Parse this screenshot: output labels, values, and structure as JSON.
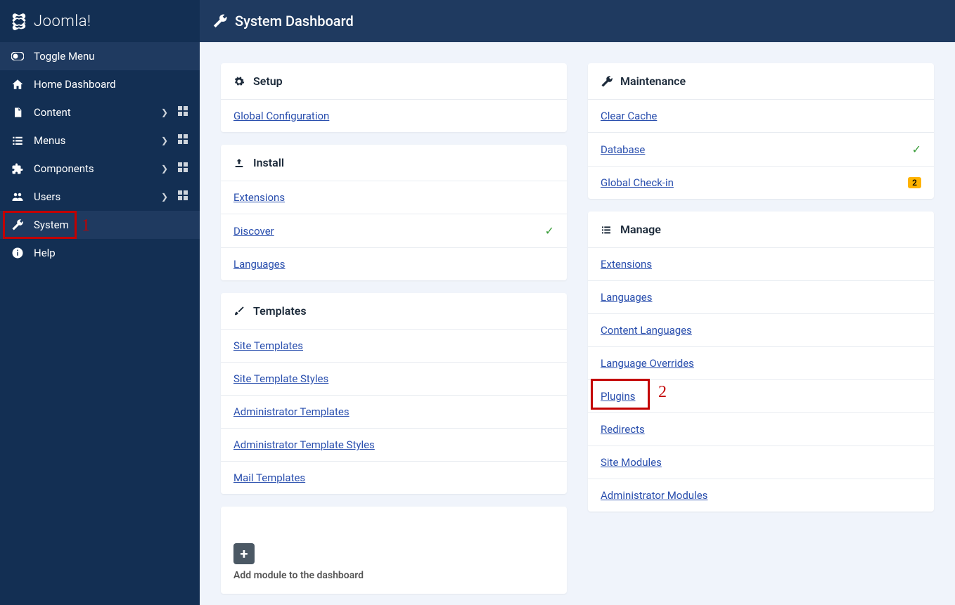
{
  "brand": "Joomla!",
  "page_title": "System Dashboard",
  "sidebar": {
    "toggle": "Toggle Menu",
    "items": [
      {
        "icon": "home",
        "label": "Home Dashboard",
        "expand": false,
        "grid": false
      },
      {
        "icon": "file",
        "label": "Content",
        "expand": true,
        "grid": true
      },
      {
        "icon": "list",
        "label": "Menus",
        "expand": true,
        "grid": true
      },
      {
        "icon": "puzzle",
        "label": "Components",
        "expand": true,
        "grid": true
      },
      {
        "icon": "users",
        "label": "Users",
        "expand": true,
        "grid": true
      },
      {
        "icon": "wrench",
        "label": "System",
        "expand": false,
        "grid": false,
        "active": true
      },
      {
        "icon": "info",
        "label": "Help",
        "expand": false,
        "grid": false
      }
    ]
  },
  "annotations": {
    "n1": "1",
    "n2": "2"
  },
  "cards_left": [
    {
      "icon": "gear",
      "title": "Setup",
      "items": [
        {
          "label": "Global Configuration"
        }
      ]
    },
    {
      "icon": "upload",
      "title": "Install",
      "items": [
        {
          "label": "Extensions"
        },
        {
          "label": "Discover",
          "check": true
        },
        {
          "label": "Languages"
        }
      ]
    },
    {
      "icon": "brush",
      "title": "Templates",
      "items": [
        {
          "label": "Site Templates"
        },
        {
          "label": "Site Template Styles"
        },
        {
          "label": "Administrator Templates"
        },
        {
          "label": "Administrator Template Styles"
        },
        {
          "label": "Mail Templates"
        }
      ]
    }
  ],
  "cards_right": [
    {
      "icon": "wrench",
      "title": "Maintenance",
      "items": [
        {
          "label": "Clear Cache"
        },
        {
          "label": "Database",
          "check": true
        },
        {
          "label": "Global Check-in",
          "badge": "2"
        }
      ]
    },
    {
      "icon": "list-check",
      "title": "Manage",
      "items": [
        {
          "label": "Extensions"
        },
        {
          "label": "Languages"
        },
        {
          "label": "Content Languages"
        },
        {
          "label": "Language Overrides"
        },
        {
          "label": "Plugins",
          "highlight": true
        },
        {
          "label": "Redirects"
        },
        {
          "label": "Site Modules"
        },
        {
          "label": "Administrator Modules"
        }
      ]
    }
  ],
  "add_module": "Add module to the dashboard"
}
